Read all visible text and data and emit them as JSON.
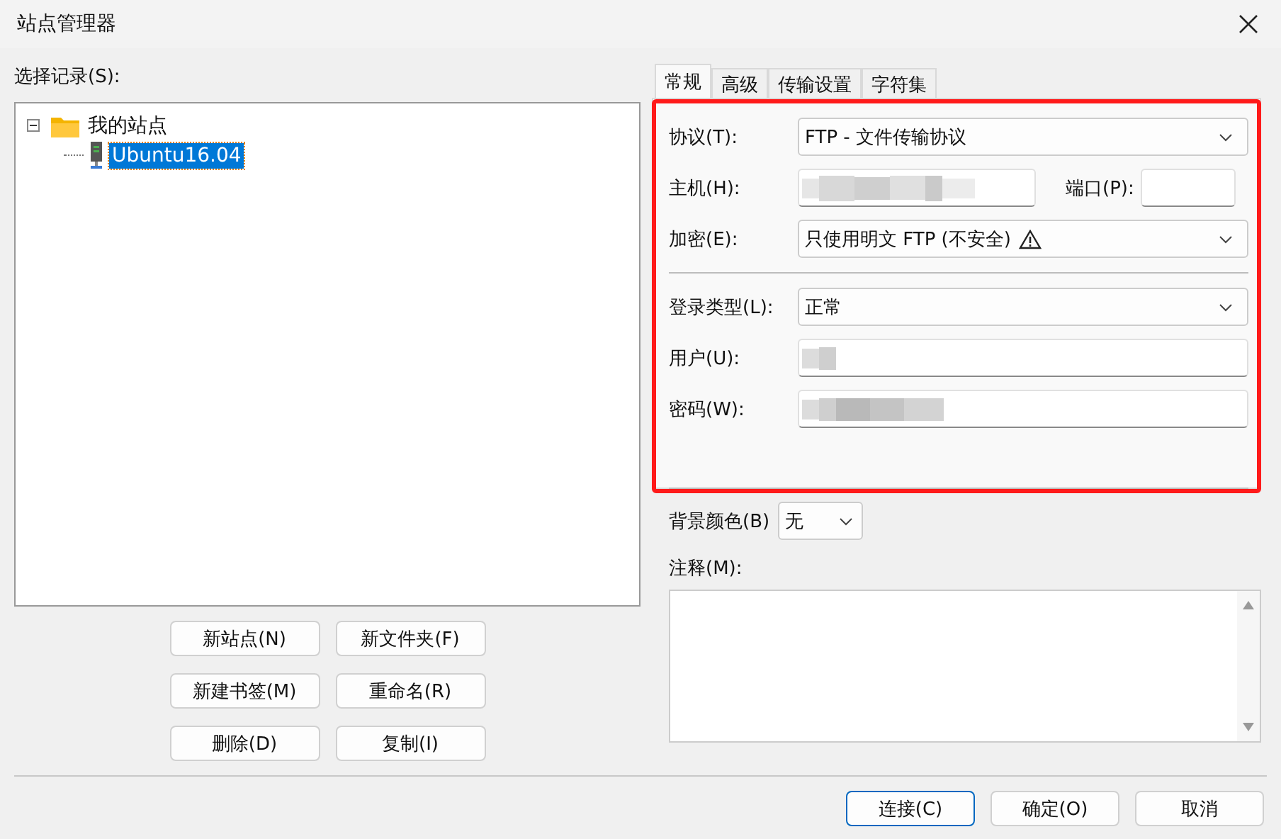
{
  "window": {
    "title": "站点管理器"
  },
  "tree": {
    "label": "选择记录(S):",
    "items": [
      {
        "label": "我的站点",
        "kind": "folder",
        "expanded": true,
        "selected": false,
        "children": [
          {
            "label": "Ubuntu16.04",
            "kind": "server",
            "selected": true
          }
        ]
      }
    ]
  },
  "left_buttons": [
    "新站点(N)",
    "新文件夹(F)",
    "新建书签(M)",
    "重命名(R)",
    "删除(D)",
    "复制(I)"
  ],
  "tabs": [
    {
      "label": "常规",
      "selected": true
    },
    {
      "label": "高级",
      "selected": false
    },
    {
      "label": "传输设置",
      "selected": false
    },
    {
      "label": "字符集",
      "selected": false
    }
  ],
  "fields": [
    {
      "label": "协议(T):",
      "kind": "select",
      "value": "FTP - 文件传输协议"
    },
    {
      "label": "主机(H):",
      "kind": "host",
      "redacted": true,
      "port_label": "端口(P):"
    },
    {
      "label": "加密(E):",
      "kind": "select",
      "value": "只使用明文 FTP (不安全)",
      "warning": true
    },
    {
      "label": "登录类型(L):",
      "kind": "select",
      "value": "正常",
      "separator_before": true
    },
    {
      "label": "用户(U):",
      "kind": "input",
      "redacted": true
    },
    {
      "label": "密码(W):",
      "kind": "input",
      "redacted": true
    }
  ],
  "background_color": {
    "label": "背景颜色(B)",
    "value": "无"
  },
  "notes": {
    "label": "注释(M):"
  },
  "highlight_frame": true,
  "dialog_buttons": [
    {
      "label": "连接(C)",
      "default": true
    },
    {
      "label": "确定(O)",
      "default": false
    },
    {
      "label": "取消",
      "default": false
    }
  ]
}
